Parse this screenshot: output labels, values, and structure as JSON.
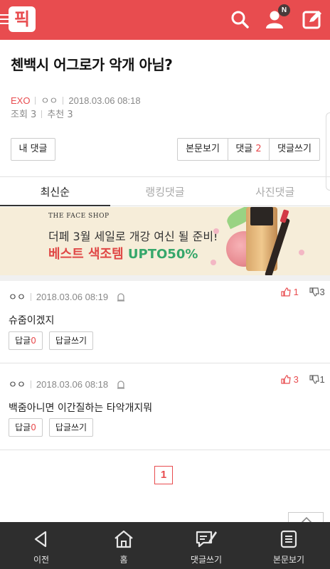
{
  "header": {
    "logo_text": "픽",
    "notification_badge": "N",
    "icons": [
      "menu-icon",
      "search-icon",
      "user-icon",
      "write-icon"
    ]
  },
  "post": {
    "title": "첸백시 어그로가 악개 아님?",
    "category": "EXO",
    "author": "ㅇㅇ",
    "datetime": "2018.03.06 08:18",
    "views": "조회 3",
    "recommends": "추천 3"
  },
  "actions": {
    "my_comments": "내 댓글",
    "view_post": "본문보기",
    "comments_label": "댓글",
    "comments_count": "2",
    "write_comment": "댓글쓰기"
  },
  "tabs": [
    {
      "label": "최신순",
      "active": true
    },
    {
      "label": "랭킹댓글",
      "active": false
    },
    {
      "label": "사진댓글",
      "active": false
    }
  ],
  "ad": {
    "brand": "THE FACE SHOP",
    "line1": "더페 3월 세일로 개강 여신 될 준비!",
    "line2_red": "베스트 색조템 ",
    "line2_green": "UPTO50%"
  },
  "comments": [
    {
      "author": "ㅇㅇ",
      "datetime": "2018.03.06 08:19",
      "up": "1",
      "down": "3",
      "text": "슈줌이겠지",
      "reply_label": "답글",
      "reply_count": "0",
      "write_reply": "답글쓰기"
    },
    {
      "author": "ㅇㅇ",
      "datetime": "2018.03.06 08:18",
      "up": "3",
      "down": "1",
      "text": "백줌아니면 이간질하는 타악개지뭐",
      "reply_label": "답글",
      "reply_count": "0",
      "write_reply": "답글쓰기"
    }
  ],
  "pagination": {
    "current": "1"
  },
  "bottom_nav": [
    {
      "label": "이전",
      "icon": "back-icon"
    },
    {
      "label": "홈",
      "icon": "home-icon"
    },
    {
      "label": "댓글쓰기",
      "icon": "comment-write-icon"
    },
    {
      "label": "본문보기",
      "icon": "document-icon"
    }
  ],
  "colors": {
    "brand": "#e84c4f",
    "bottom_bar": "#2e2e2e",
    "ad_bg": "#f6edd9"
  }
}
